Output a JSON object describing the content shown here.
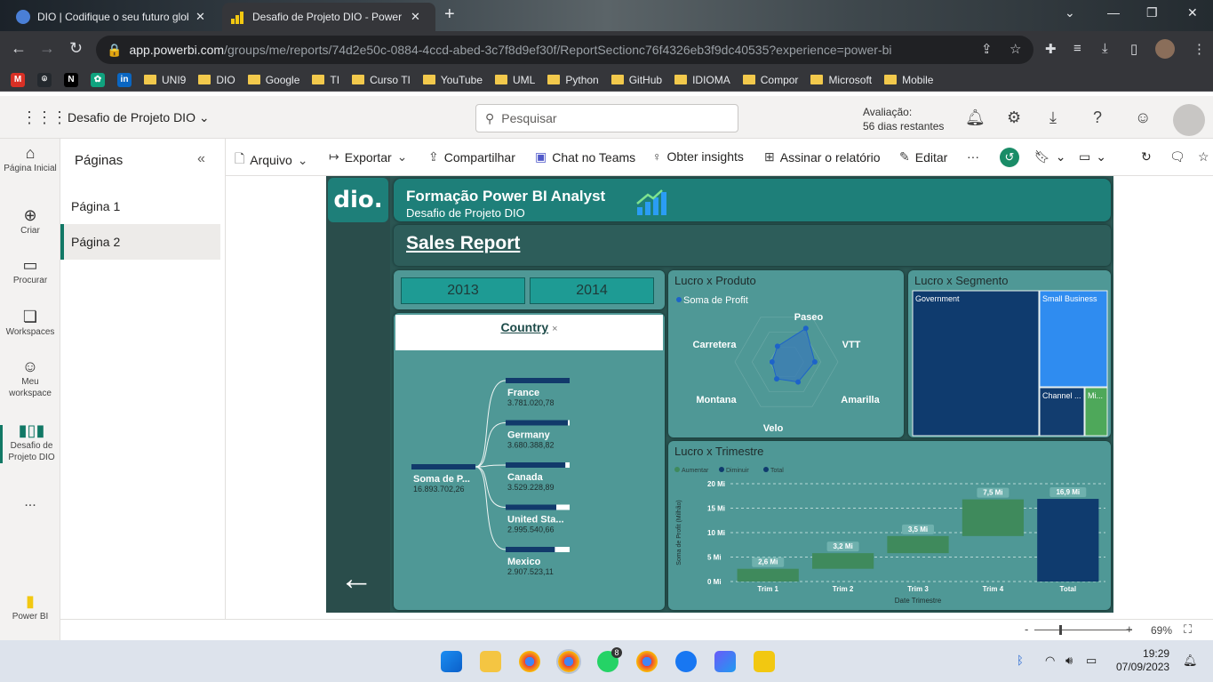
{
  "browser": {
    "tabs": [
      {
        "title": "DIO | Codifique o seu futuro glob"
      },
      {
        "title": "Desafio de Projeto DIO - Power BI"
      }
    ],
    "url_host": "app.powerbi.com",
    "url_path": "/groups/me/reports/74d2e50c-0884-4ccd-abed-3c7f8d9ef30f/ReportSectionc76f4326eb3f9dc40535?experience=power-bi",
    "bookmarks": [
      "UNI9",
      "DIO",
      "Google",
      "TI",
      "Curso TI",
      "YouTube",
      "UML",
      "Python",
      "GitHub",
      "IDIOMA",
      "Compor",
      "Microsoft",
      "Mobile"
    ]
  },
  "pbi_header": {
    "workspace": "Desafio de Projeto DIO",
    "search_placeholder": "Pesquisar",
    "trial_line1": "Avaliação:",
    "trial_line2": "56 dias restantes"
  },
  "left_nav": {
    "home": "Página Inicial",
    "create": "Criar",
    "browse": "Procurar",
    "workspaces": "Workspaces",
    "my_workspace": "Meu workspace",
    "current": "Desafio de Projeto DIO",
    "more": "...",
    "powerbi": "Power BI"
  },
  "pages": {
    "title": "Páginas",
    "items": [
      "Página 1",
      "Página 2"
    ],
    "selected": "Página 2"
  },
  "toolbar": {
    "file": "Arquivo",
    "export": "Exportar",
    "share": "Compartilhar",
    "chat": "Chat no Teams",
    "insights": "Obter insights",
    "subscribe": "Assinar o relatório",
    "edit": "Editar",
    "more": "···"
  },
  "report": {
    "logo": "dio.",
    "banner_title": "Formação Power BI Analyst",
    "banner_subtitle": "Desafio de Projeto DIO",
    "sales_title": "Sales Report",
    "years": [
      "2013",
      "2014"
    ],
    "country_label": "Country",
    "country_clear": "×"
  },
  "decomposition": {
    "root_label": "Soma de P...",
    "root_value": "16.893.702,26",
    "items": [
      {
        "name": "France",
        "value": "3.781.020,78",
        "fill": 1.0
      },
      {
        "name": "Germany",
        "value": "3.680.388,82",
        "fill": 0.973
      },
      {
        "name": "Canada",
        "value": "3.529.228,89",
        "fill": 0.933
      },
      {
        "name": "United Sta...",
        "value": "2.995.540,66",
        "fill": 0.792
      },
      {
        "name": "Mexico",
        "value": "2.907.523,11",
        "fill": 0.769
      }
    ]
  },
  "radar": {
    "title": "Lucro x Produto",
    "legend": "Soma de Profit",
    "axes": [
      "Paseo",
      "VTT",
      "Amarilla",
      "Velo",
      "Montana",
      "Carretera"
    ],
    "values": [
      0.75,
      0.55,
      0.45,
      0.38,
      0.28,
      0.35
    ]
  },
  "treemap": {
    "title": "Lucro x Segmento",
    "segments": [
      {
        "name": "Government",
        "color": "#0f3b6e"
      },
      {
        "name": "Small Business",
        "color": "#2f8cf0"
      },
      {
        "name": "Channel ...",
        "color": "#123d6f"
      },
      {
        "name": "Mi...",
        "color": "#4ea85a"
      }
    ]
  },
  "chart_data": {
    "type": "waterfall",
    "title": "Lucro x Trimestre",
    "legend": [
      "Aumentar",
      "Diminuir",
      "Total"
    ],
    "xlabel": "Date Trimestre",
    "ylabel": "Soma de Profit (Milhão)",
    "categories": [
      "Trim 1",
      "Trim 2",
      "Trim 3",
      "Trim 4",
      "Total"
    ],
    "values": [
      2.6,
      3.2,
      3.5,
      7.5,
      16.9
    ],
    "data_labels": [
      "2,6 Mi",
      "3,2 Mi",
      "3,5 Mi",
      "7,5 Mi",
      "16,9 Mi"
    ],
    "yticks": [
      "0 Mi",
      "5 Mi",
      "10 Mi",
      "15 Mi",
      "20 Mi"
    ],
    "ylim": [
      0,
      20
    ],
    "colors": {
      "increase": "#3f8a5c",
      "total": "#0f3b6e"
    }
  },
  "statusbar": {
    "zoom": "69%"
  },
  "taskbar": {
    "time": "19:29",
    "date": "07/09/2023",
    "whatsapp_badge": "8"
  }
}
